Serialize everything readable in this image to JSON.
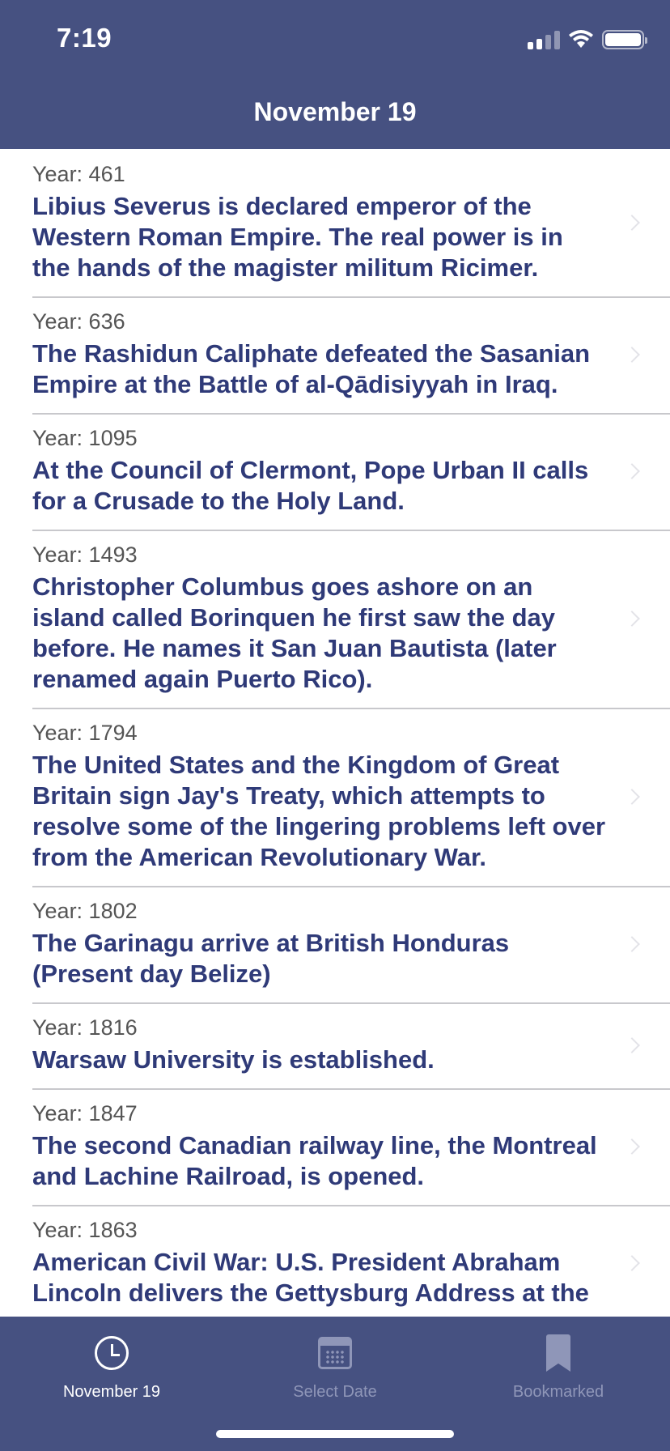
{
  "status_bar": {
    "time": "7:19"
  },
  "nav": {
    "title": "November 19"
  },
  "events": [
    {
      "year": "Year: 461",
      "text": "Libius Severus is declared emperor of the Western Roman Empire. The real power is in the hands of the magister militum Ricimer."
    },
    {
      "year": "Year: 636",
      "text": "The Rashidun Caliphate defeated the Sasanian Empire at the Battle of al-Qādisiyyah in Iraq."
    },
    {
      "year": "Year: 1095",
      "text": "At the Council of Clermont, Pope Urban II calls for a Crusade to the Holy Land."
    },
    {
      "year": "Year: 1493",
      "text": "Christopher Columbus goes ashore on an island called Borinquen he first saw the day before. He names it San Juan Bautista (later renamed again Puerto Rico)."
    },
    {
      "year": "Year: 1794",
      "text": "The United States and the Kingdom of Great Britain sign Jay's Treaty, which attempts to resolve some of the lingering problems left over from the American Revolutionary War."
    },
    {
      "year": "Year: 1802",
      "text": "The Garinagu arrive at British Honduras (Present day Belize)"
    },
    {
      "year": "Year: 1816",
      "text": "Warsaw University is established."
    },
    {
      "year": "Year: 1847",
      "text": "The second Canadian railway line, the Montreal and Lachine Railroad, is opened."
    },
    {
      "year": "Year: 1863",
      "text": "American Civil War: U.S. President Abraham Lincoln delivers the Gettysburg Address at the"
    }
  ],
  "tabs": [
    {
      "label": "November 19",
      "icon": "clock-icon",
      "active": true
    },
    {
      "label": "Select Date",
      "icon": "calendar-icon",
      "active": false
    },
    {
      "label": "Bookmarked",
      "icon": "bookmark-icon",
      "active": false
    }
  ],
  "colors": {
    "brand": "#465181",
    "event_text": "#2f3a78",
    "tab_inactive": "#8f96b8"
  }
}
